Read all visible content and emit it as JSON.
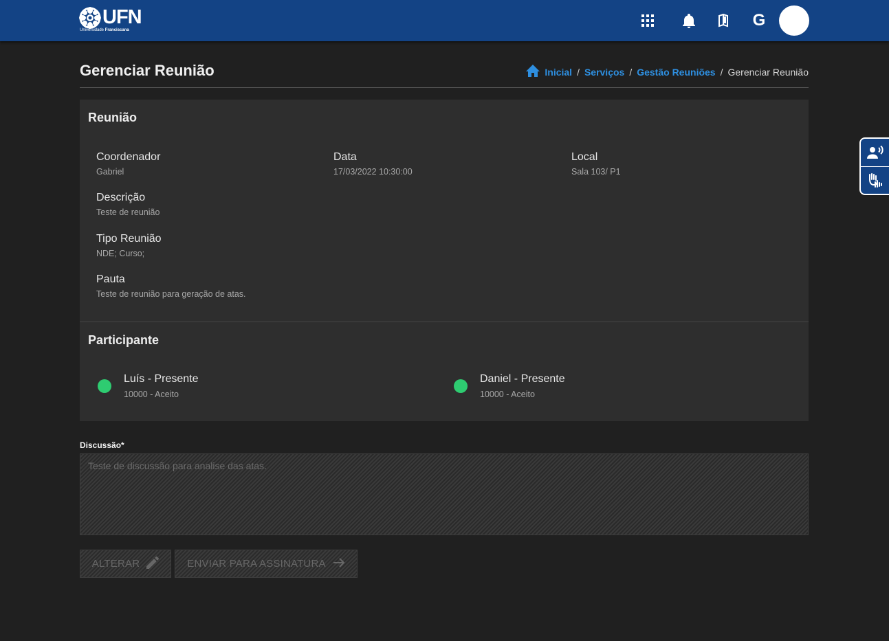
{
  "header": {
    "logo_text": "UFN",
    "logo_sub_a": "Universidade",
    "logo_sub_b": "Franciscana",
    "google_letter": "G",
    "icons": [
      "apps-grid-icon",
      "bell-icon",
      "book-icon",
      "google-icon",
      "avatar"
    ]
  },
  "page": {
    "title": "Gerenciar Reunião",
    "breadcrumb": {
      "items": [
        "Inicial",
        "Serviços",
        "Gestão Reuniões"
      ],
      "current": "Gerenciar Reunião",
      "separator": "/"
    }
  },
  "meeting": {
    "section_title": "Reunião",
    "fields": {
      "coordenador": {
        "label": "Coordenador",
        "value": "Gabriel"
      },
      "data": {
        "label": "Data",
        "value": "17/03/2022 10:30:00"
      },
      "local": {
        "label": "Local",
        "value": "Sala 103/ P1"
      },
      "descricao": {
        "label": "Descrição",
        "value": "Teste de reunião"
      },
      "tipo": {
        "label": "Tipo Reunião",
        "value": "NDE; Curso;"
      },
      "pauta": {
        "label": "Pauta",
        "value": "Teste de reunião para geração de atas."
      }
    }
  },
  "participants": {
    "section_title": "Participante",
    "items": [
      {
        "name": "Luís - Presente",
        "detail": "10000 - Aceito",
        "status_color": "#2ecc71"
      },
      {
        "name": "Daniel - Presente",
        "detail": "10000 - Aceito",
        "status_color": "#2ecc71"
      }
    ]
  },
  "discussion": {
    "label": "Discussão*",
    "placeholder": "Teste de discussão para analise das atas."
  },
  "actions": {
    "edit_label": "ALTERAR",
    "send_label": "ENVIAR PARA ASSINATURA"
  },
  "accessibility": {
    "icons": [
      "audio-description-icon",
      "sign-language-icon"
    ]
  },
  "colors": {
    "header_bg": "#134385",
    "page_bg": "#202020",
    "card_bg": "#2e2e2e",
    "link": "#2e8fe0",
    "status_present": "#2ecc71"
  }
}
